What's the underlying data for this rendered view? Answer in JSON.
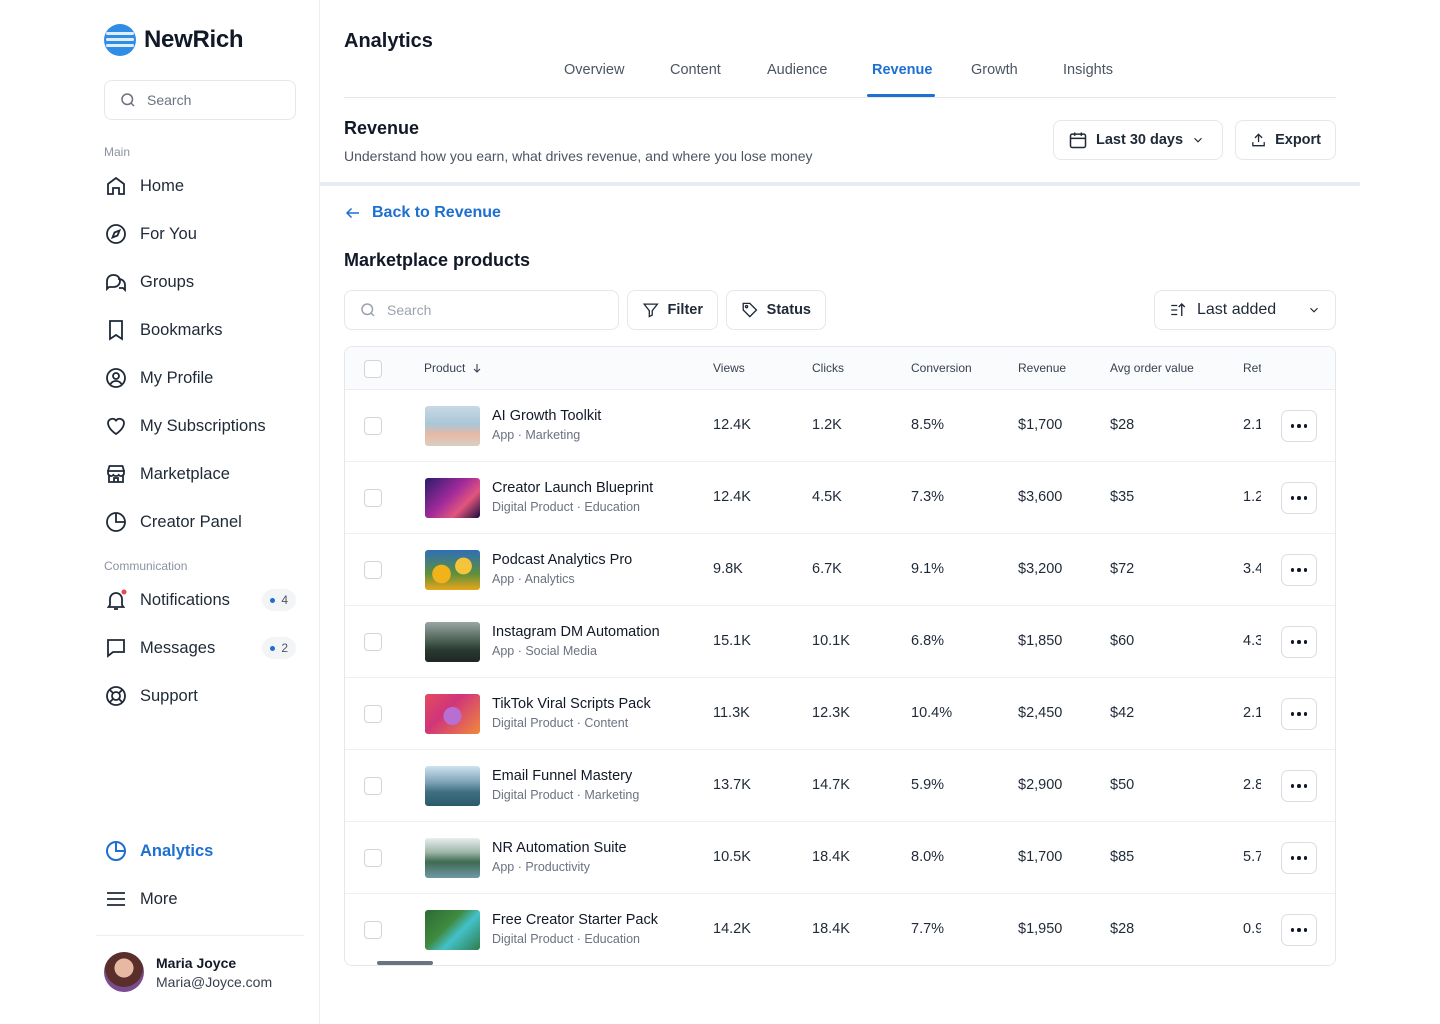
{
  "brand": {
    "name": "NewRich",
    "accent": "#1d6fd1"
  },
  "sidebar": {
    "search_placeholder": "Search",
    "main_label": "Main",
    "communication_label": "Communication",
    "items": [
      {
        "label": "Home",
        "icon": "home-icon"
      },
      {
        "label": "For You",
        "icon": "compass-icon"
      },
      {
        "label": "Groups",
        "icon": "chat-bubbles-icon"
      },
      {
        "label": "Bookmarks",
        "icon": "bookmark-icon"
      },
      {
        "label": "My Profile",
        "icon": "user-circle-icon"
      },
      {
        "label": "My Subscriptions",
        "icon": "heart-icon"
      },
      {
        "label": "Marketplace",
        "icon": "store-icon"
      },
      {
        "label": "Creator Panel",
        "icon": "pie-chart-icon"
      }
    ],
    "comm_items": [
      {
        "label": "Notifications",
        "icon": "bell-icon",
        "count": "4"
      },
      {
        "label": "Messages",
        "icon": "message-icon",
        "count": "2"
      },
      {
        "label": "Support",
        "icon": "lifebuoy-icon"
      }
    ],
    "analytics_label": "Analytics",
    "more_label": "More",
    "user": {
      "name": "Maria Joyce",
      "email": "Maria@Joyce.com"
    }
  },
  "header": {
    "title": "Analytics",
    "tabs": [
      "Overview",
      "Content",
      "Audience",
      "Revenue",
      "Growth",
      "Insights"
    ],
    "active_tab": "Revenue"
  },
  "revenue": {
    "title": "Revenue",
    "subtitle": "Understand how you earn, what drives revenue, and where you lose money",
    "date_range": "Last 30 days",
    "export_label": "Export"
  },
  "back_label": "Back to Revenue",
  "section_title": "Marketplace products",
  "toolbar": {
    "search_placeholder": "Search",
    "filter_label": "Filter",
    "status_label": "Status",
    "sort_label": "Last added"
  },
  "table": {
    "columns": [
      "Product",
      "Views",
      "Clicks",
      "Conversion",
      "Revenue",
      "Avg order value",
      "Ret"
    ],
    "rows": [
      {
        "name": "AI Growth Toolkit",
        "meta": "App · Marketing",
        "views": "12.4K",
        "clicks": "1.2K",
        "conversion": "8.5%",
        "revenue": "$1,700",
        "aov": "$28",
        "ret": "2.1"
      },
      {
        "name": "Creator Launch Blueprint",
        "meta": "Digital Product · Education",
        "views": "12.4K",
        "clicks": "4.5K",
        "conversion": "7.3%",
        "revenue": "$3,600",
        "aov": "$35",
        "ret": "1.2"
      },
      {
        "name": "Podcast Analytics Pro",
        "meta": "App · Analytics",
        "views": "9.8K",
        "clicks": "6.7K",
        "conversion": "9.1%",
        "revenue": "$3,200",
        "aov": "$72",
        "ret": "3.4"
      },
      {
        "name": "Instagram DM Automation",
        "meta": "App · Social Media",
        "views": "15.1K",
        "clicks": "10.1K",
        "conversion": "6.8%",
        "revenue": "$1,850",
        "aov": "$60",
        "ret": "4.3"
      },
      {
        "name": "TikTok Viral Scripts Pack",
        "meta": "Digital Product · Content",
        "views": "11.3K",
        "clicks": "12.3K",
        "conversion": "10.4%",
        "revenue": "$2,450",
        "aov": "$42",
        "ret": "2.1"
      },
      {
        "name": "Email Funnel Mastery",
        "meta": "Digital Product · Marketing",
        "views": "13.7K",
        "clicks": "14.7K",
        "conversion": "5.9%",
        "revenue": "$2,900",
        "aov": "$50",
        "ret": "2.8"
      },
      {
        "name": "NR Automation Suite",
        "meta": "App · Productivity",
        "views": "10.5K",
        "clicks": "18.4K",
        "conversion": "8.0%",
        "revenue": "$1,700",
        "aov": "$85",
        "ret": "5.7"
      },
      {
        "name": "Free Creator Starter Pack",
        "meta": "Digital Product · Education",
        "views": "14.2K",
        "clicks": "18.4K",
        "conversion": "7.7%",
        "revenue": "$1,950",
        "aov": "$28",
        "ret": "0.9"
      }
    ]
  }
}
